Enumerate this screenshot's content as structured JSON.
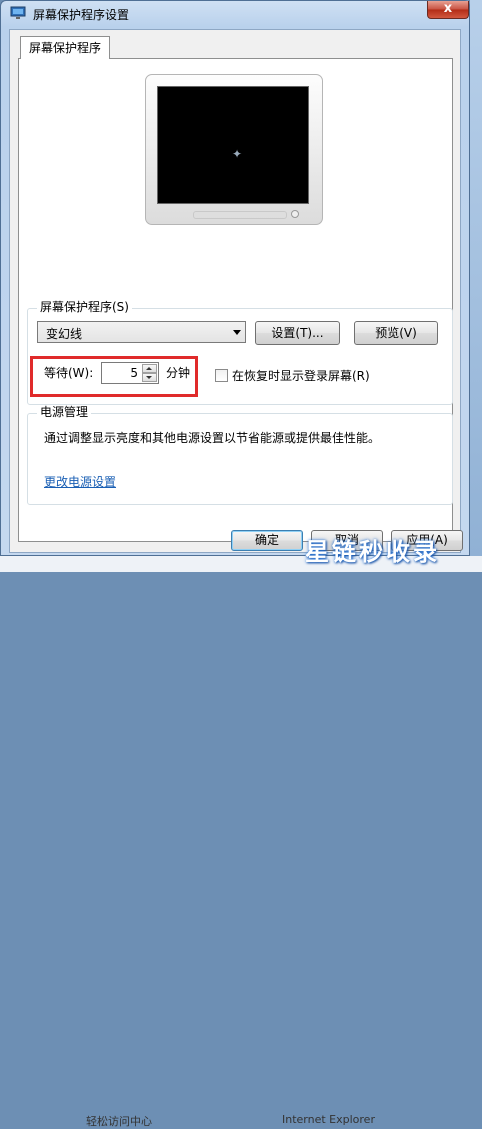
{
  "window": {
    "title": "屏幕保护程序设置",
    "close_glyph": "x"
  },
  "tabs": [
    {
      "label": "屏幕保护程序"
    }
  ],
  "screensaver": {
    "group_label": "屏幕保护程序(S)",
    "selected": "变幻线",
    "settings_button": "设置(T)...",
    "preview_button": "预览(V)",
    "wait_label": "等待(W):",
    "wait_value": "5",
    "wait_unit": "分钟",
    "resume_checkbox_label": "在恢复时显示登录屏幕(R)",
    "resume_checked": false
  },
  "power": {
    "group_label": "电源管理",
    "description": "通过调整显示亮度和其他电源设置以节省能源或提供最佳性能。",
    "link": "更改电源设置"
  },
  "footer": {
    "ok_button": "确定",
    "cancel_button": "取消",
    "apply_button": "应用(A)"
  },
  "watermark": "星链秒收录",
  "background": {
    "bottom_text_left": "轻松访问中心",
    "bottom_text_right": "Internet Explorer"
  },
  "colors": {
    "highlight": "#e02a2a",
    "link": "#1a5fb4"
  }
}
